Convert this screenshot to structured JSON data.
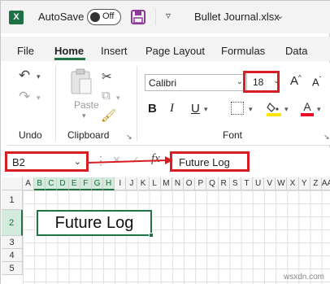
{
  "titlebar": {
    "autosave_label": "AutoSave",
    "autosave_state": "Off",
    "document_title": "Bullet Journal.xlsx"
  },
  "tabs": [
    {
      "label": "File",
      "active": false
    },
    {
      "label": "Home",
      "active": true
    },
    {
      "label": "Insert",
      "active": false
    },
    {
      "label": "Page Layout",
      "active": false
    },
    {
      "label": "Formulas",
      "active": false
    },
    {
      "label": "Data",
      "active": false
    }
  ],
  "ribbon": {
    "undo_group_label": "Undo",
    "clipboard_group_label": "Clipboard",
    "paste_label": "Paste",
    "font_group_label": "Font",
    "font_name": "Calibri",
    "font_size": "18",
    "bold": "B",
    "italic": "I",
    "underline": "U",
    "grow_font": "A",
    "shrink_font": "A",
    "font_color_letter": "A"
  },
  "formula_bar": {
    "name_box": "B2",
    "formula_value": "Future Log",
    "fx": "fx"
  },
  "grid": {
    "columns": [
      "A",
      "B",
      "C",
      "D",
      "E",
      "F",
      "G",
      "H",
      "I",
      "J",
      "K",
      "L",
      "M",
      "N",
      "O",
      "P",
      "Q",
      "R",
      "S",
      "T",
      "U",
      "V",
      "W",
      "X",
      "Y",
      "Z",
      "AA"
    ],
    "selected_columns": [
      "B",
      "C",
      "D",
      "E",
      "F",
      "G",
      "H"
    ],
    "rows": [
      "1",
      "2",
      "3",
      "4",
      "5"
    ],
    "selected_row": "2",
    "cell_text": "Future Log"
  },
  "colors": {
    "excel_green": "#217346",
    "highlight_red": "#d81e22",
    "fill_yellow": "#ffe600",
    "font_red": "#e81123"
  },
  "watermark": "wsxdn.com"
}
